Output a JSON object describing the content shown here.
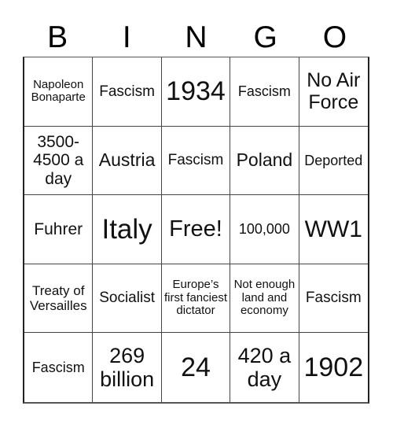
{
  "header": {
    "letters": [
      "B",
      "I",
      "N",
      "G",
      "O"
    ]
  },
  "board": {
    "rows": [
      [
        "Napoleon Bonaparte",
        "Fascism",
        "1934",
        "Fascism",
        "No Air Force"
      ],
      [
        "3500-4500 a day",
        "Austria",
        "Fascism",
        "Poland",
        "Deported"
      ],
      [
        "Fuhrer",
        "Italy",
        "Free!",
        "100,000",
        "WW1"
      ],
      [
        "Treaty of Versailles",
        "Socialist",
        "Europe’s first fanciest dictator",
        "Not enough land and economy",
        "Fascism"
      ],
      [
        "Fascism",
        "269 billion",
        "24",
        "420 a day",
        "1902"
      ]
    ],
    "free_space": {
      "row": 2,
      "col": 2,
      "label": "Free!"
    }
  },
  "colors": {
    "grid_line": "#444444",
    "text": "#111111",
    "background": "#ffffff"
  }
}
